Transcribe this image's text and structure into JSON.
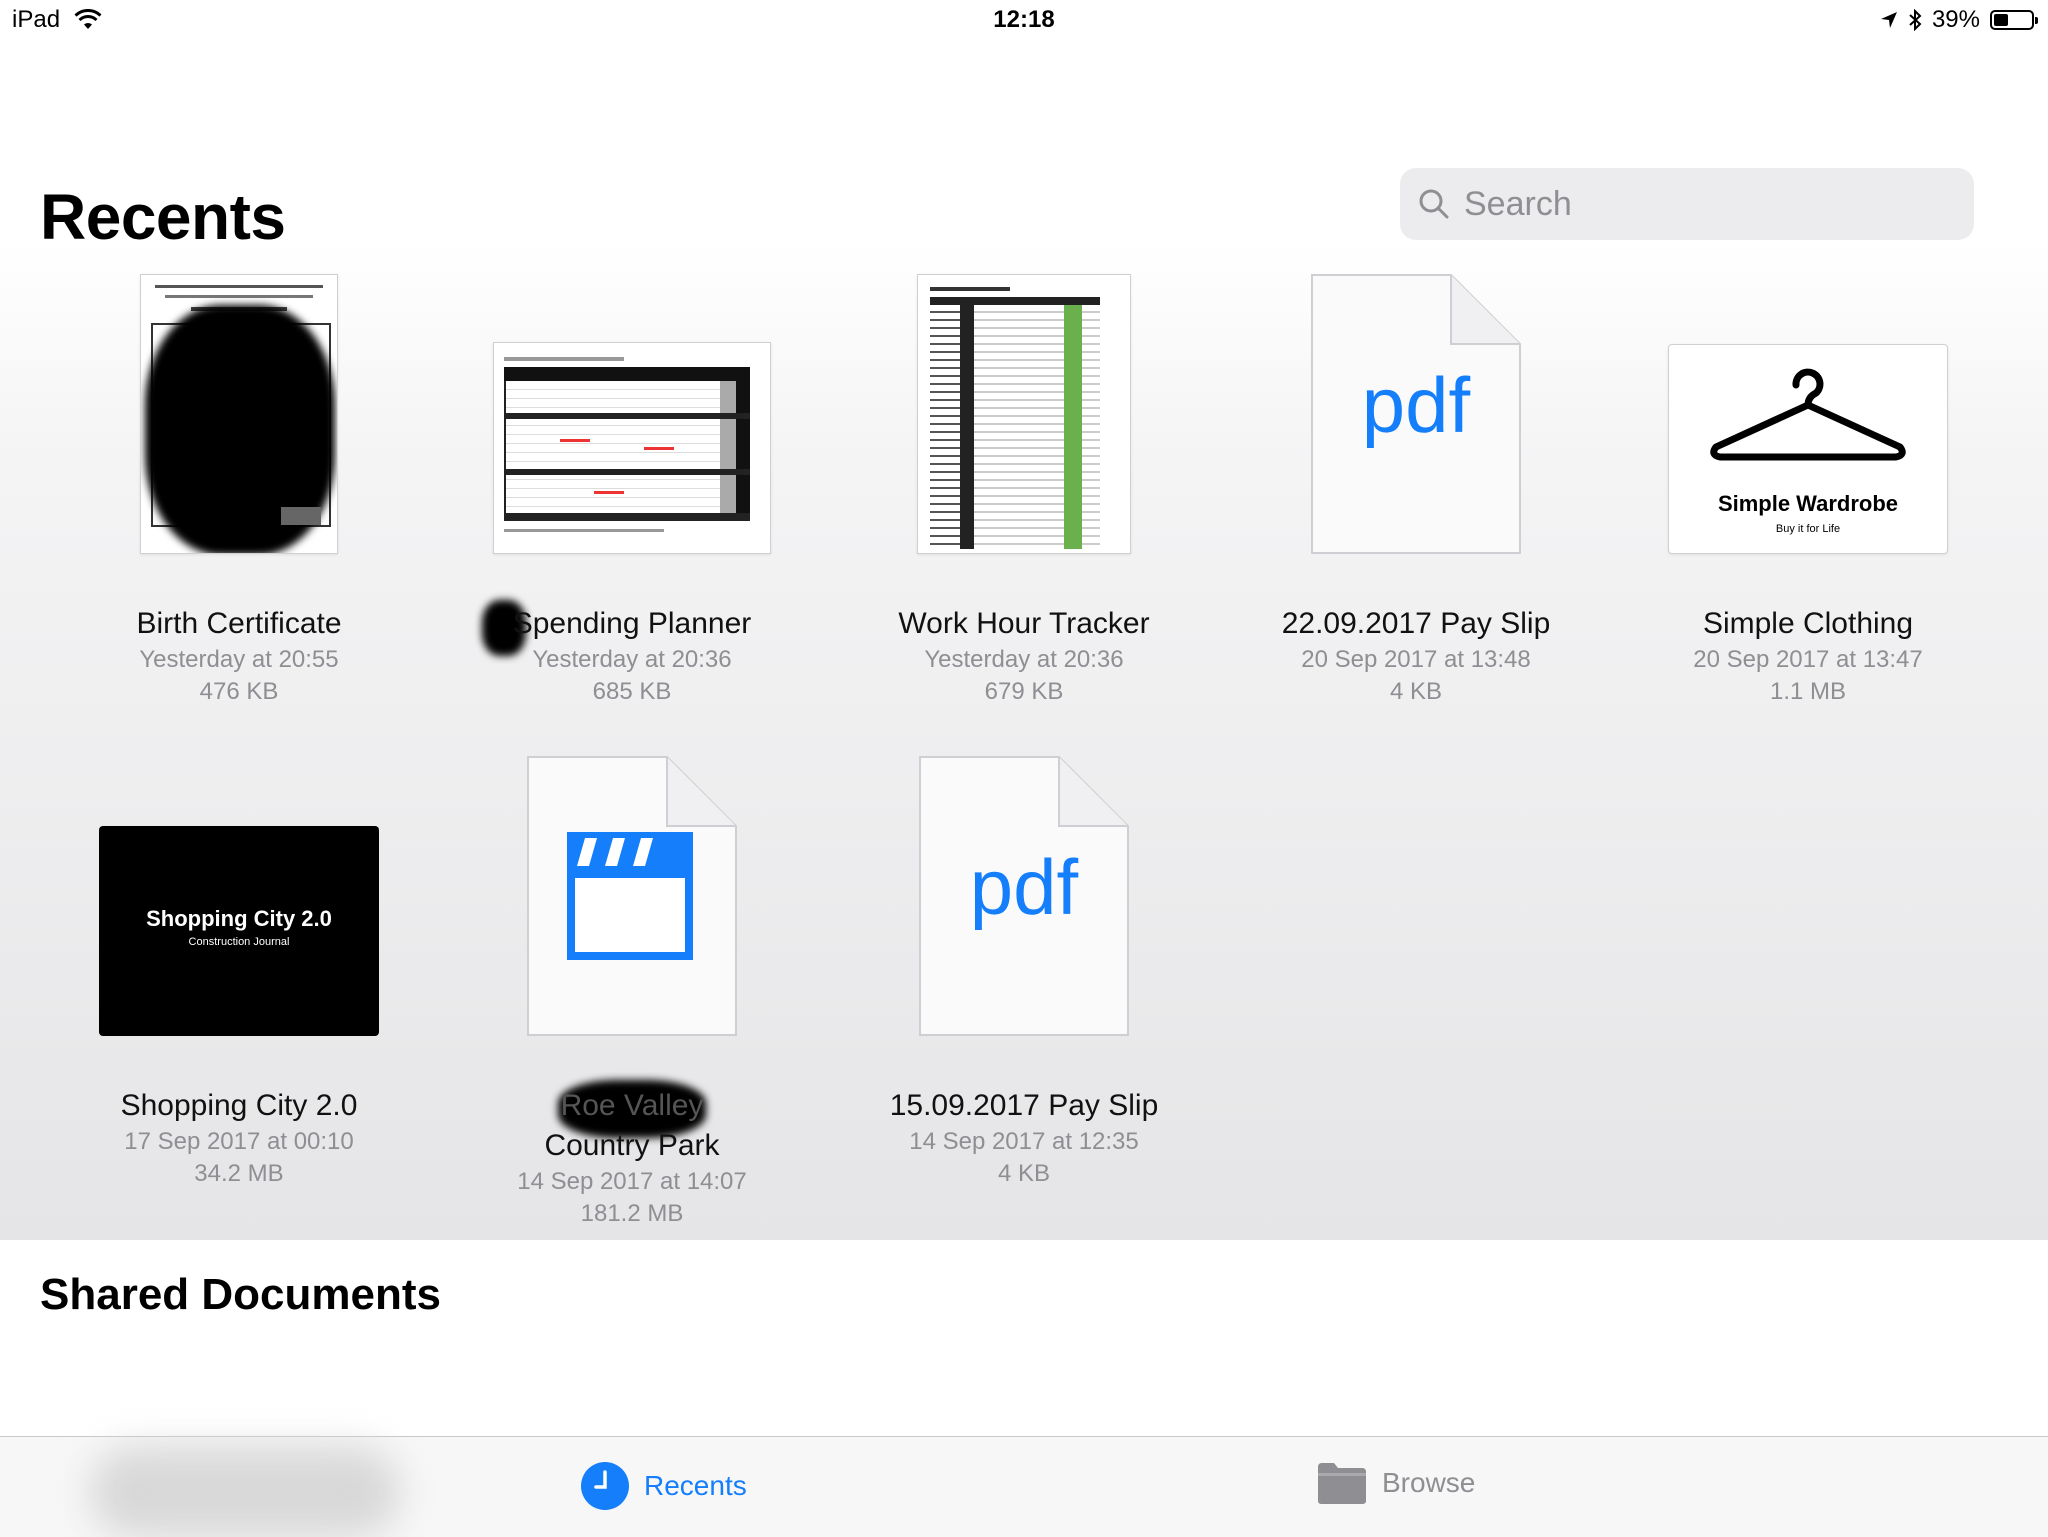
{
  "status_bar": {
    "device": "iPad",
    "time": "12:18",
    "battery_percent_label": "39%",
    "battery_level": 0.39
  },
  "header": {
    "title": "Recents",
    "search_placeholder": "Search"
  },
  "files": [
    {
      "name": "Birth Certificate",
      "date": "Yesterday at 20:55",
      "size": "476 KB",
      "thumb": "scanned-document"
    },
    {
      "name": "Spending Planner",
      "date": "Yesterday at 20:36",
      "size": "685 KB",
      "thumb": "spreadsheet-landscape"
    },
    {
      "name": "Work Hour Tracker",
      "date": "Yesterday at 20:36",
      "size": "679 KB",
      "thumb": "spreadsheet-portrait"
    },
    {
      "name": "22.09.2017 Pay Slip",
      "date": "20 Sep 2017 at 13:48",
      "size": "4 KB",
      "thumb": "pdf-icon",
      "thumb_label": "pdf"
    },
    {
      "name": "Simple Clothing",
      "date": "20 Sep 2017 at 13:47",
      "size": "1.1 MB",
      "thumb": "hanger-card",
      "thumb_title": "Simple Wardrobe",
      "thumb_subtitle": "Buy it for Life"
    },
    {
      "name": "Shopping City 2.0",
      "date": "17 Sep 2017 at 00:10",
      "size": "34.2 MB",
      "thumb": "black-slide",
      "thumb_title": "Shopping City 2.0",
      "thumb_subtitle": "Construction Journal"
    },
    {
      "name_line1": "Roe Valley",
      "name_line2": "Country Park",
      "date": "14 Sep 2017 at 14:07",
      "size": "181.2 MB",
      "thumb": "video-icon"
    },
    {
      "name": "15.09.2017 Pay Slip",
      "date": "14 Sep 2017 at 12:35",
      "size": "4 KB",
      "thumb": "pdf-icon",
      "thumb_label": "pdf"
    }
  ],
  "shared": {
    "title": "Shared Documents"
  },
  "tabs": [
    {
      "label": "Recents",
      "icon": "clock-icon",
      "active": true
    },
    {
      "label": "Browse",
      "icon": "folder-icon",
      "active": false
    }
  ],
  "colors": {
    "accent": "#147EFB",
    "secondary_text": "#8E8E93"
  }
}
